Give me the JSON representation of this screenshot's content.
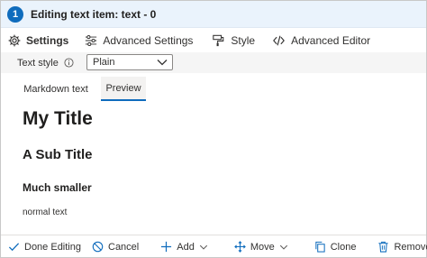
{
  "header": {
    "step_number": "1",
    "title": "Editing text item: text - 0"
  },
  "tabs": [
    {
      "label": "Settings",
      "icon": "gear-icon",
      "active": true
    },
    {
      "label": "Advanced Settings",
      "icon": "sliders-icon",
      "active": false
    },
    {
      "label": "Style",
      "icon": "paint-brush-icon",
      "active": false
    },
    {
      "label": "Advanced Editor",
      "icon": "code-icon",
      "active": false
    }
  ],
  "text_style": {
    "label": "Text style",
    "value": "Plain",
    "info_icon": "info-icon",
    "dropdown_icon": "chevron-down-icon"
  },
  "editor_tabs": [
    {
      "label": "Markdown text",
      "active": false
    },
    {
      "label": "Preview",
      "active": true
    }
  ],
  "preview": {
    "heading1": "My Title",
    "heading2": "A Sub Title",
    "heading3": "Much smaller",
    "paragraph": "normal text"
  },
  "toolbar": {
    "done": "Done Editing",
    "cancel": "Cancel",
    "add": "Add",
    "move": "Move",
    "clone": "Clone",
    "remove": "Remove"
  },
  "colors": {
    "accent": "#0f6cbd",
    "header_bg": "#eaf3fc",
    "icon": "#0f6cbd"
  }
}
